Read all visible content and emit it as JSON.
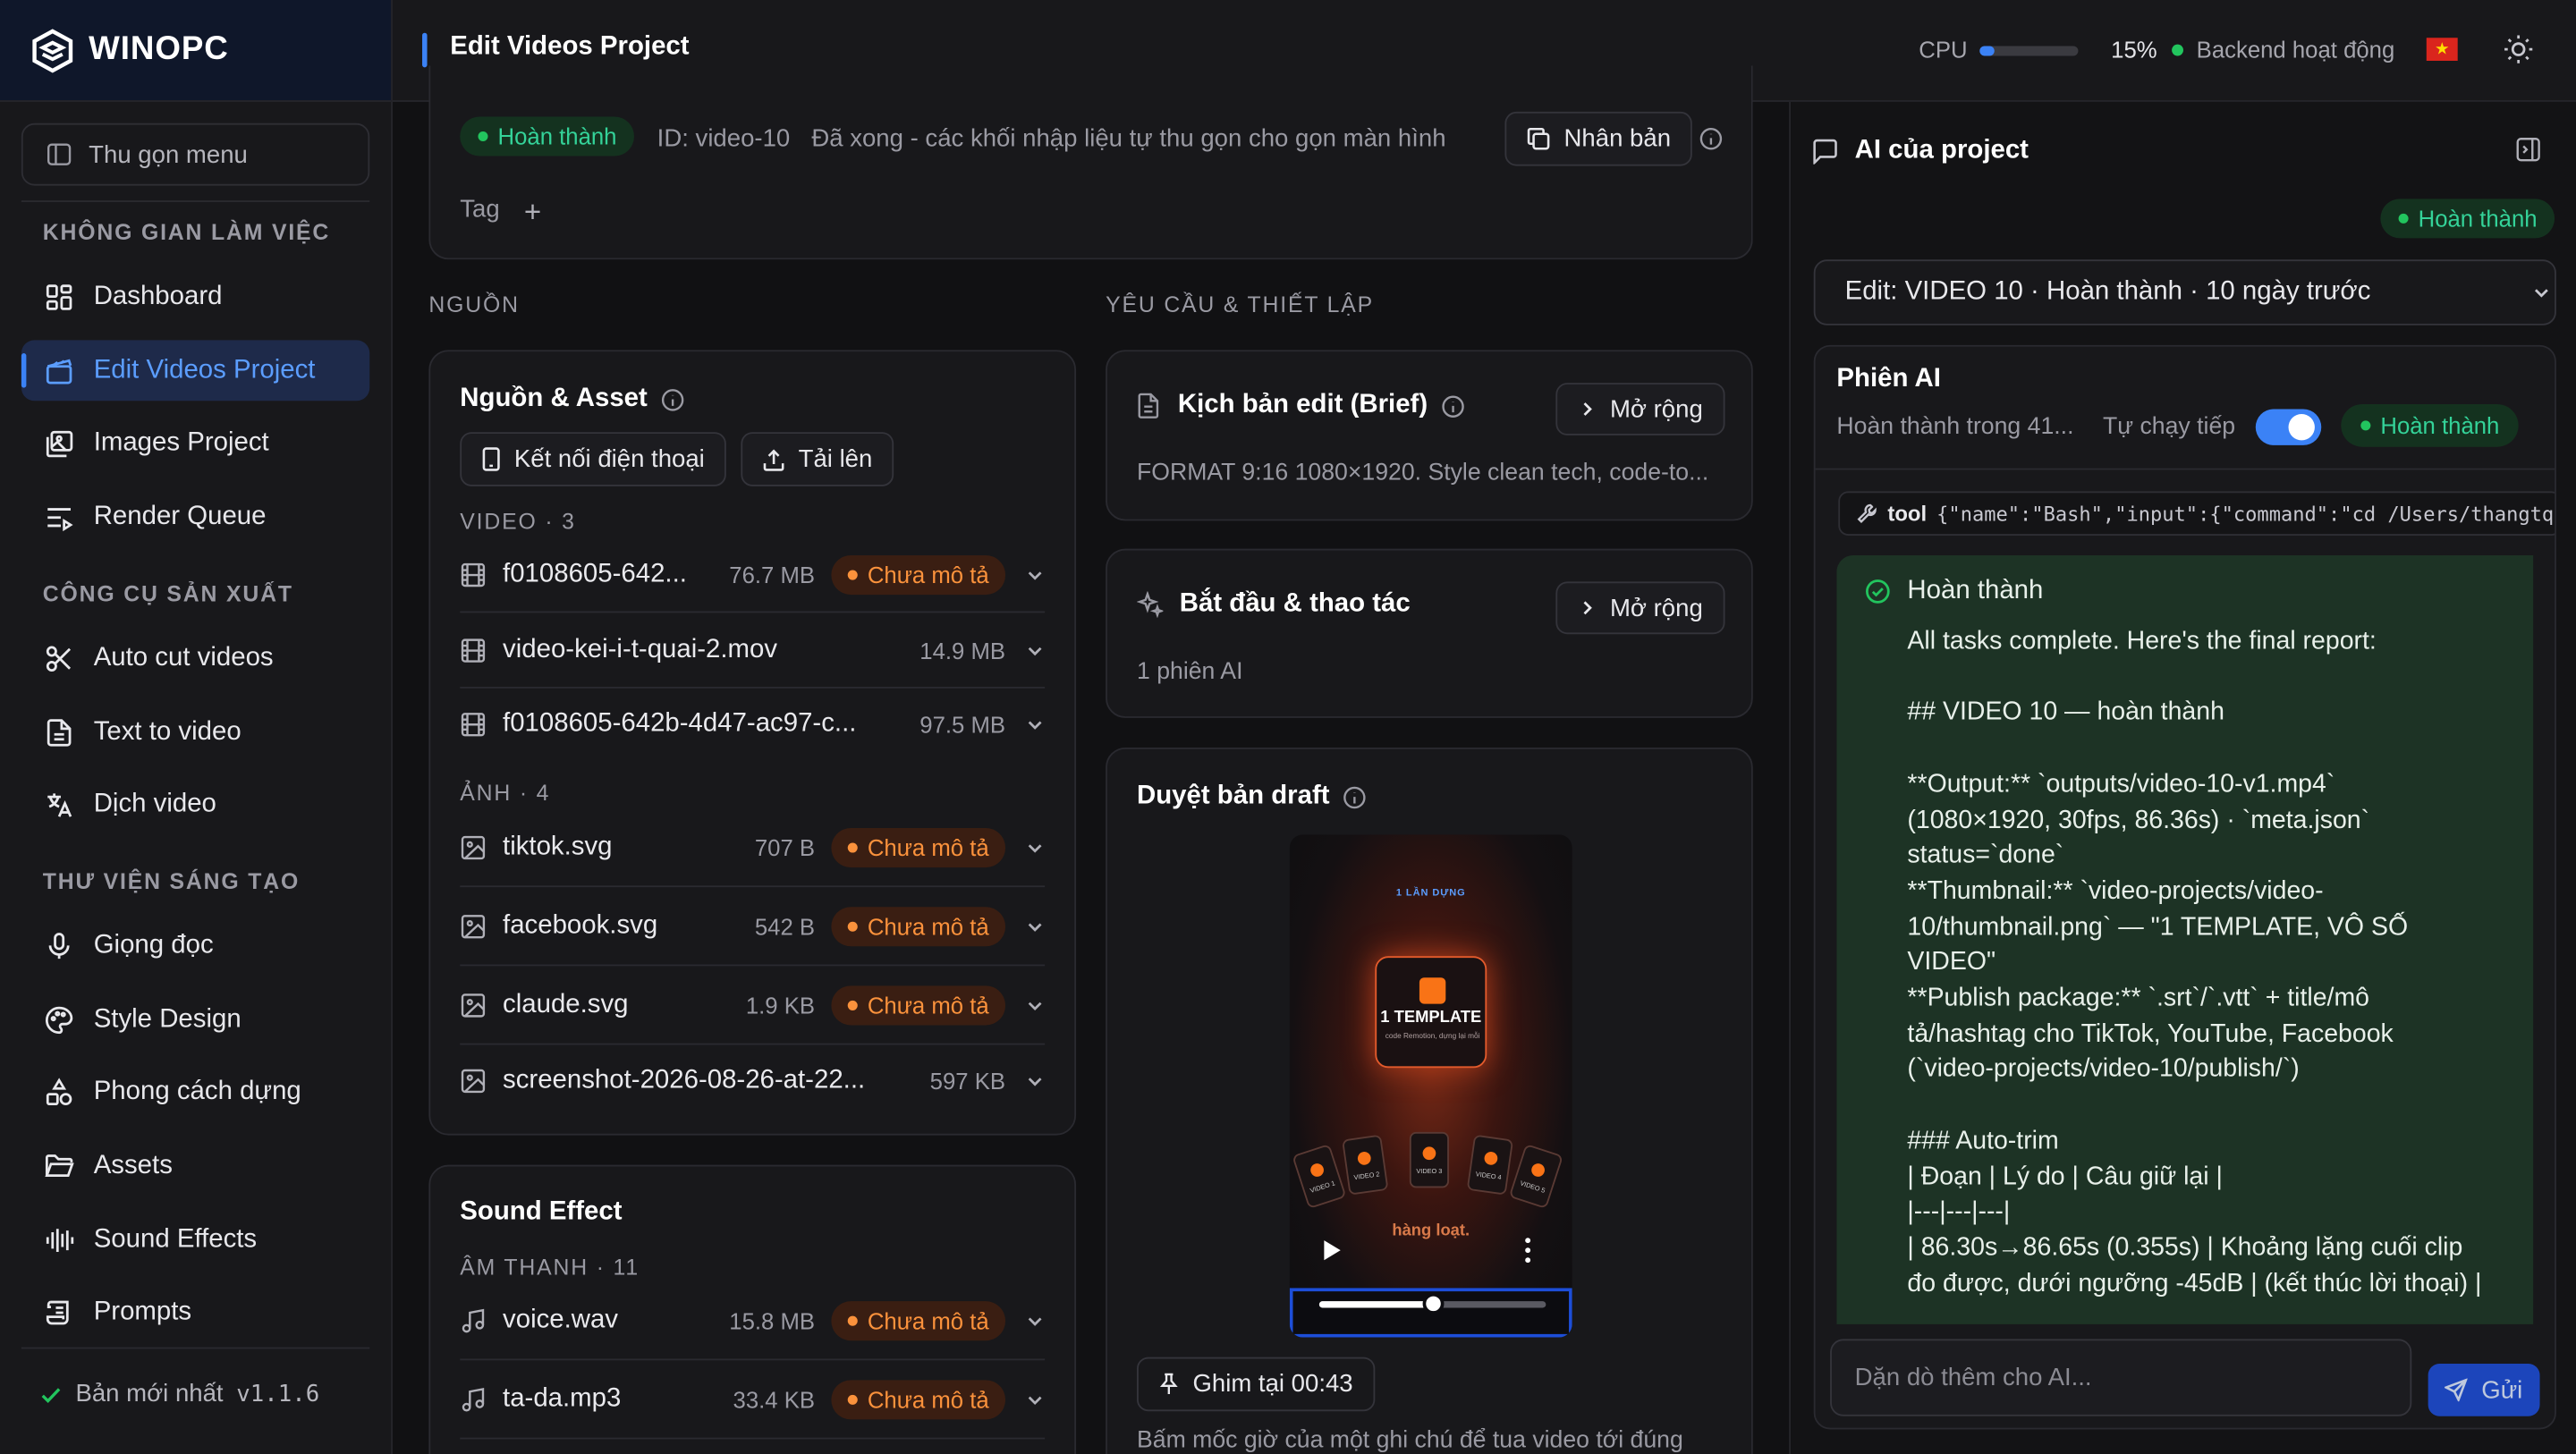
{
  "app": {
    "brand": "WINOPC"
  },
  "sidebar": {
    "collapse_label": "Thu gọn menu",
    "sections": [
      {
        "title": "KHÔNG GIAN LÀM VIỆC"
      },
      {
        "title": "CÔNG CỤ SẢN XUẤT"
      },
      {
        "title": "THƯ VIỆN SÁNG TẠO"
      }
    ],
    "items": [
      {
        "label": "Dashboard",
        "icon": "grid-icon"
      },
      {
        "label": "Edit Videos Project",
        "icon": "clapper-icon",
        "active": true
      },
      {
        "label": "Images Project",
        "icon": "images-icon"
      },
      {
        "label": "Render Queue",
        "icon": "list-play-icon"
      },
      {
        "label": "Auto cut videos",
        "icon": "scissors-icon"
      },
      {
        "label": "Text to video",
        "icon": "file-text-icon"
      },
      {
        "label": "Dịch video",
        "icon": "translate-icon"
      },
      {
        "label": "Giọng đọc",
        "icon": "mic-icon"
      },
      {
        "label": "Style Design",
        "icon": "palette-icon"
      },
      {
        "label": "Phong cách dựng",
        "icon": "shapes-icon"
      },
      {
        "label": "Assets",
        "icon": "folder-icon"
      },
      {
        "label": "Sound Effects",
        "icon": "audio-lines-icon"
      },
      {
        "label": "Prompts",
        "icon": "scroll-icon"
      }
    ],
    "version_label": "Bản mới nhất",
    "version": "v1.1.6"
  },
  "topbar": {
    "title": "Edit Videos Project",
    "cpu_label": "CPU",
    "cpu_percent": 15,
    "cpu_value": "15%",
    "backend_status": "Backend hoạt động",
    "accent": "#3b82f6"
  },
  "project": {
    "status": "Hoàn thành",
    "id_label": "ID: video-10",
    "status_desc": "Đã xong - các khối nhập liệu tự thu gọn cho gọn màn hình",
    "duplicate_label": "Nhân bản",
    "tag_label": "Tag"
  },
  "sources": {
    "section_label": "NGUỒN",
    "card_title": "Nguồn & Asset",
    "connect_phone": "Kết nối điện thoại",
    "upload": "Tải lên",
    "video_label": "VIDEO · 3",
    "videos": [
      {
        "name": "f0108605-642...",
        "size": "76.7 MB",
        "badge": "Chưa mô tả"
      },
      {
        "name": "video-kei-i-t-quai-2.mov",
        "size": "14.9 MB",
        "badge": ""
      },
      {
        "name": "f0108605-642b-4d47-ac97-c...",
        "size": "97.5 MB",
        "badge": ""
      }
    ],
    "image_label": "ẢNH · 4",
    "images": [
      {
        "name": "tiktok.svg",
        "size": "707 B",
        "badge": "Chưa mô tả"
      },
      {
        "name": "facebook.svg",
        "size": "542 B",
        "badge": "Chưa mô tả"
      },
      {
        "name": "claude.svg",
        "size": "1.9 KB",
        "badge": "Chưa mô tả"
      },
      {
        "name": "screenshot-2026-08-26-at-22...",
        "size": "597 KB",
        "badge": ""
      }
    ]
  },
  "sound": {
    "card_title": "Sound Effect",
    "label": "ÂM THANH · 11",
    "items": [
      {
        "name": "voice.wav",
        "size": "15.8 MB",
        "badge": "Chưa mô tả"
      },
      {
        "name": "ta-da.mp3",
        "size": "33.4 KB",
        "badge": "Chưa mô tả"
      }
    ]
  },
  "requirements": {
    "section_label": "YÊU CẦU & THIẾT LẬP",
    "brief_title": "Kịch bản edit (Brief)",
    "expand": "Mở rộng",
    "brief_text": "FORMAT 9:16 1080×1920. Style clean tech, code-to...",
    "start_title": "Bắt đầu & thao tác",
    "start_text": "1 phiên AI",
    "draft_title": "Duyệt bản draft",
    "video_top_text": "1 LẦN DỰNG",
    "video_main_text": "1 TEMPLATE",
    "video_sub_text": "code Remotion, dựng lại mỗi",
    "video_caption": "hàng loạt.",
    "video_card_labels": [
      "VIDEO 1",
      "VIDEO 2",
      "VIDEO 3",
      "VIDEO 4",
      "VIDEO 5"
    ],
    "playback_progress": 0.5,
    "pin_label": "Ghim tại 00:43",
    "pin_hint": "Bấm mốc giờ của một ghi chú để tua video tới đúng"
  },
  "ai": {
    "title": "AI của project",
    "status": "Hoàn thành",
    "select_value": "Edit: VIDEO 10 · Hoàn thành · 10 ngày trước",
    "session_title": "Phiên AI",
    "session_status": "Hoàn thành trong 41...",
    "autorun_label": "Tự chạy tiếp",
    "autorun_on": true,
    "tool_label": "tool",
    "tool_text": "{\"name\":\"Bash\",\"input\":{\"command\":\"cd /Users/thangtq/Des",
    "report_status": "Hoàn thành",
    "report_lines": [
      "All tasks complete. Here's the final report:",
      "",
      "## VIDEO 10 — hoàn thành",
      "",
      "**Output:** `outputs/video-10-v1.mp4`",
      "(1080×1920, 30fps, 86.36s) · `meta.json`",
      "status=`done`",
      "**Thumbnail:** `video-projects/video-",
      "10/thumbnail.png` — \"1 TEMPLATE, VÔ SỐ",
      "VIDEO\"",
      "**Publish package:** `.srt`/`.vtt` + title/mô",
      "tả/hashtag cho TikTok, YouTube, Facebook",
      "(`video-projects/video-10/publish/`)",
      "",
      "### Auto-trim",
      "| Đoạn | Lý do | Câu giữ lại |",
      "|---|---|---|",
      "| 86.30s→86.65s (0.355s) | Khoảng lặng cuối clip",
      "đo được, dưới ngưỡng -45dB | (kết thúc lời thoại) |"
    ],
    "input_placeholder": "Dặn dò thêm cho AI...",
    "send_label": "Gửi"
  }
}
